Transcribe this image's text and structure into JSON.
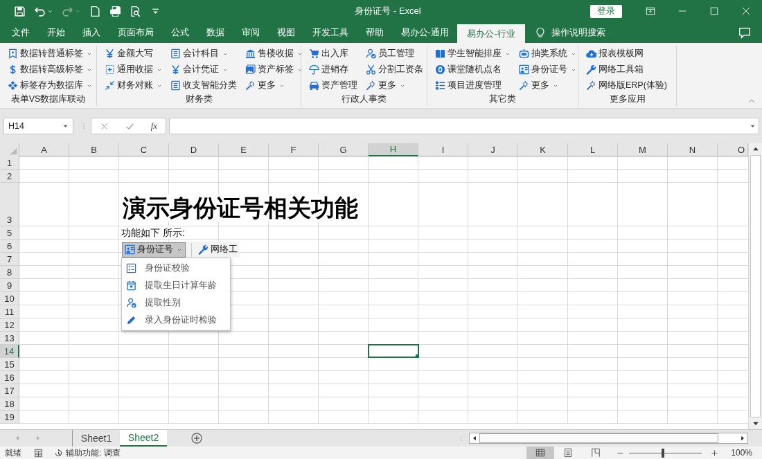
{
  "window": {
    "title": "身份证号 - Excel",
    "login_button": "登录"
  },
  "tabs": [
    {
      "label": "文件",
      "selected": false
    },
    {
      "label": "开始",
      "selected": false
    },
    {
      "label": "插入",
      "selected": false
    },
    {
      "label": "页面布局",
      "selected": false
    },
    {
      "label": "公式",
      "selected": false
    },
    {
      "label": "数据",
      "selected": false
    },
    {
      "label": "审阅",
      "selected": false
    },
    {
      "label": "视图",
      "selected": false
    },
    {
      "label": "开发工具",
      "selected": false
    },
    {
      "label": "帮助",
      "selected": false
    },
    {
      "label": "易办公-通用",
      "selected": false
    },
    {
      "label": "易办公-行业",
      "selected": true
    }
  ],
  "tell_me": "操作说明搜索",
  "ribbon": {
    "groups": [
      {
        "label": "表单VS数据库联动",
        "columns": [
          [
            {
              "label": "数据转普通标签",
              "dropdown": true
            },
            {
              "label": "数据转高级标签",
              "dropdown": true
            },
            {
              "label": "标签存为数据库",
              "dropdown": true
            }
          ]
        ]
      },
      {
        "label": "财务类",
        "columns": [
          [
            {
              "label": "金额大写",
              "dropdown": false
            },
            {
              "label": "通用收据",
              "dropdown": true
            },
            {
              "label": "财务对账",
              "dropdown": true
            }
          ],
          [
            {
              "label": "会计科目",
              "dropdown": true
            },
            {
              "label": "会计凭证",
              "dropdown": true
            },
            {
              "label": "收支智能分类",
              "dropdown": false
            }
          ],
          [
            {
              "label": "售楼收据",
              "dropdown": true
            },
            {
              "label": "资产标签",
              "dropdown": true
            },
            {
              "label": "更多",
              "dropdown": true
            }
          ]
        ]
      },
      {
        "label": "行政人事类",
        "columns": [
          [
            {
              "label": "出入库",
              "dropdown": false
            },
            {
              "label": "进销存",
              "dropdown": false
            },
            {
              "label": "资产管理",
              "dropdown": false
            }
          ],
          [
            {
              "label": "员工管理",
              "dropdown": false
            },
            {
              "label": "分割工资条",
              "dropdown": false
            },
            {
              "label": "更多",
              "dropdown": true
            }
          ]
        ]
      },
      {
        "label": "其它类",
        "columns": [
          [
            {
              "label": "学生智能排座",
              "dropdown": true
            },
            {
              "label": "课堂随机点名",
              "dropdown": false
            },
            {
              "label": "项目进度管理",
              "dropdown": false
            }
          ],
          [
            {
              "label": "抽奖系统",
              "dropdown": true
            },
            {
              "label": "身份证号",
              "dropdown": true
            },
            {
              "label": "更多",
              "dropdown": true
            }
          ]
        ]
      },
      {
        "label": "更多应用",
        "columns": [
          [
            {
              "label": "报表模板网",
              "dropdown": false
            },
            {
              "label": "网络工具箱",
              "dropdown": false
            },
            {
              "label": "网络版ERP(体验)",
              "dropdown": false
            }
          ]
        ]
      }
    ]
  },
  "formula_bar": {
    "name_box": "H14",
    "function_label": "fx"
  },
  "sheet": {
    "columns": [
      {
        "label": "A",
        "selected": false
      },
      {
        "label": "B",
        "selected": false
      },
      {
        "label": "C",
        "selected": false
      },
      {
        "label": "D",
        "selected": false
      },
      {
        "label": "E",
        "selected": false
      },
      {
        "label": "F",
        "selected": false
      },
      {
        "label": "G",
        "selected": false
      },
      {
        "label": "H",
        "selected": true
      },
      {
        "label": "I",
        "selected": false
      },
      {
        "label": "J",
        "selected": false
      },
      {
        "label": "K",
        "selected": false
      },
      {
        "label": "L",
        "selected": false
      },
      {
        "label": "M",
        "selected": false
      },
      {
        "label": "N",
        "selected": false
      },
      {
        "label": "O",
        "selected": false
      }
    ],
    "rows": [
      {
        "label": "1",
        "selected": false
      },
      {
        "label": "2",
        "selected": false
      },
      {
        "label": "3",
        "selected": false,
        "content": {
          "kind": "title",
          "text": "演示身份证号相关功能"
        }
      },
      {
        "label": "5",
        "selected": false,
        "content": {
          "kind": "text",
          "text": "功能如下 所示:"
        }
      },
      {
        "label": "6",
        "selected": false,
        "content": {
          "kind": "snippet",
          "button": "身份证号",
          "pressed": true,
          "next_label": "网络工",
          "menu": [
            "身份证校验",
            "提取生日计算年龄",
            "提取性别",
            "录入身份证时检验"
          ]
        }
      },
      {
        "label": "7",
        "selected": false
      },
      {
        "label": "8",
        "selected": false
      },
      {
        "label": "9",
        "selected": false
      },
      {
        "label": "10",
        "selected": false
      },
      {
        "label": "11",
        "selected": false
      },
      {
        "label": "12",
        "selected": false
      },
      {
        "label": "13",
        "selected": false
      },
      {
        "label": "14",
        "selected": true
      },
      {
        "label": "15",
        "selected": false
      },
      {
        "label": "16",
        "selected": false
      },
      {
        "label": "17",
        "selected": false
      },
      {
        "label": "18",
        "selected": false
      },
      {
        "label": "19",
        "selected": false
      }
    ]
  },
  "sheet_tabs": [
    {
      "label": "Sheet1",
      "selected": false
    },
    {
      "label": "Sheet2",
      "selected": true
    }
  ],
  "status_bar": {
    "status": "就绪",
    "accessibility": "辅助功能: 调查",
    "views": [
      {
        "selected": true
      },
      {
        "selected": false
      },
      {
        "selected": false
      }
    ],
    "zoom": {
      "level": 0.46,
      "reading": "100%"
    }
  }
}
